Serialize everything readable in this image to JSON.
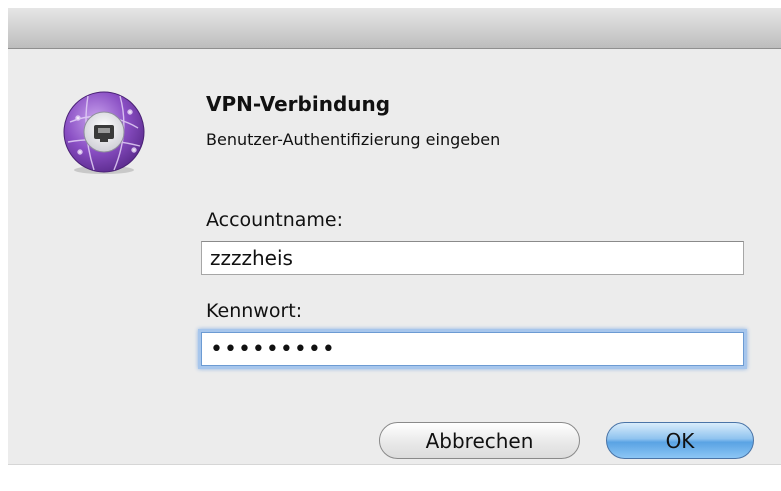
{
  "dialog": {
    "title": "VPN-Verbindung",
    "subtitle": "Benutzer-Authentifizierung eingeben"
  },
  "account": {
    "label": "Accountname:",
    "value": "zzzzheis"
  },
  "password": {
    "label": "Kennwort:",
    "value": "•••••••••"
  },
  "buttons": {
    "cancel_label": "Abbrechen",
    "ok_label": "OK"
  },
  "icon": {
    "name": "vpn-network-icon",
    "color": "#7b3fb3"
  }
}
